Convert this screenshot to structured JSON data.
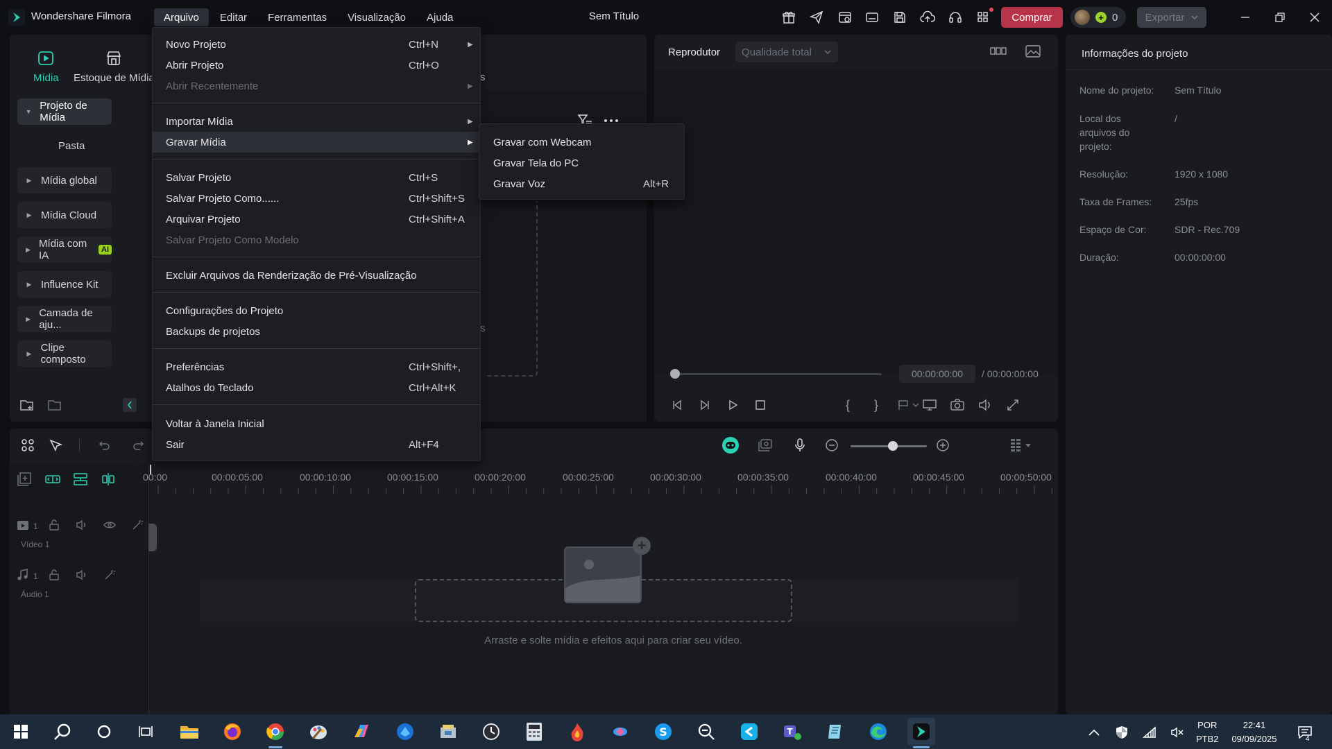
{
  "app": {
    "name": "Wondershare Filmora",
    "window_title": "Sem Título"
  },
  "menubar": [
    {
      "label": "Arquivo",
      "active": true
    },
    {
      "label": "Editar"
    },
    {
      "label": "Ferramentas"
    },
    {
      "label": "Visualização"
    },
    {
      "label": "Ajuda"
    }
  ],
  "titlebar": {
    "icons": [
      "gift-icon",
      "send-icon",
      "media-manager-icon",
      "subtitle-icon",
      "save-icon",
      "cloud-upload-icon",
      "headset-icon",
      "apps-grid-icon"
    ],
    "buy_label": "Comprar",
    "credits": "0",
    "export_label": "Exportar"
  },
  "media_panel": {
    "tabs": [
      {
        "label": "Mídia",
        "icon": "media-icon",
        "active": true
      },
      {
        "label": "Estoque de Mídia",
        "icon": "stock-media-icon"
      }
    ],
    "sidebar": [
      {
        "label": "Projeto de Mídia",
        "selected": true
      },
      {
        "label": "Pasta",
        "sub": true
      },
      {
        "label": "Mídia global"
      },
      {
        "label": "Mídia Cloud"
      },
      {
        "label": "Mídia com IA",
        "badge": "AI"
      },
      {
        "label": "Influence Kit"
      },
      {
        "label": "Camada de aju..."
      },
      {
        "label": "Clipe composto"
      }
    ],
    "partial_texts": [
      "s",
      "s"
    ]
  },
  "player": {
    "label": "Reprodutor",
    "quality": "Qualidade total",
    "current_time": "00:00:00:00",
    "total_time": "/  00:00:00:00"
  },
  "project_info": {
    "title": "Informações do projeto",
    "rows": [
      {
        "label": "Nome do projeto:",
        "value": "Sem Título"
      },
      {
        "label": "Local dos arquivos do projeto:",
        "value": "/"
      },
      {
        "label": "Resolução:",
        "value": "1920 x 1080"
      },
      {
        "label": "Taxa de Frames:",
        "value": "25fps"
      },
      {
        "label": "Espaço de Cor:",
        "value": "SDR - Rec.709"
      },
      {
        "label": "Duração:",
        "value": "00:00:00:00"
      }
    ]
  },
  "timeline": {
    "ruler": [
      "00:00",
      "00:00:05:00",
      "00:00:10:00",
      "00:00:15:00",
      "00:00:20:00",
      "00:00:25:00",
      "00:00:30:00",
      "00:00:35:00",
      "00:00:40:00",
      "00:00:45:00",
      "00:00:50:00"
    ],
    "tracks": [
      {
        "name": "Vídeo 1",
        "index": "1"
      },
      {
        "name": "Áudio 1",
        "index": "1"
      }
    ],
    "drop_hint": "Arraste e solte mídia e efeitos aqui para criar seu vídeo.",
    "zoom_level": 0.55
  },
  "file_menu": {
    "items": [
      {
        "label": "Novo Projeto",
        "shortcut": "Ctrl+N",
        "submenu": true
      },
      {
        "label": "Abrir Projeto",
        "shortcut": "Ctrl+O"
      },
      {
        "label": "Abrir Recentemente",
        "submenu": true,
        "disabled": true
      },
      {
        "label": "Importar Mídia",
        "submenu": true
      },
      {
        "label": "Gravar Mídia",
        "submenu": true,
        "hover": true
      },
      {
        "label": "Salvar Projeto",
        "shortcut": "Ctrl+S"
      },
      {
        "label": "Salvar Projeto Como......",
        "shortcut": "Ctrl+Shift+S"
      },
      {
        "label": "Arquivar Projeto",
        "shortcut": "Ctrl+Shift+A"
      },
      {
        "label": "Salvar Projeto Como Modelo",
        "disabled": true
      },
      {
        "label": "Excluir Arquivos da Renderização de Pré-Visualização"
      },
      {
        "label": "Configurações do Projeto"
      },
      {
        "label": "Backups de projetos"
      },
      {
        "label": "Preferências",
        "shortcut": "Ctrl+Shift+,"
      },
      {
        "label": "Atalhos do Teclado",
        "shortcut": "Ctrl+Alt+K"
      },
      {
        "label": "Voltar à Janela Inicial"
      },
      {
        "label": "Sair",
        "shortcut": "Alt+F4"
      }
    ]
  },
  "record_submenu": {
    "items": [
      {
        "label": "Gravar com Webcam"
      },
      {
        "label": "Gravar Tela do PC"
      },
      {
        "label": "Gravar Voz",
        "shortcut": "Alt+R"
      }
    ]
  },
  "taskbar": {
    "apps": [
      "windows-start-icon",
      "search-icon",
      "task-view-icon",
      "widgets-icon",
      "file-explorer-icon",
      "firefox-icon",
      "chrome-icon",
      "paint-icon",
      "copilot-icon",
      "onedrive-icon",
      "installer-icon",
      "clock-app-icon",
      "calculator-icon",
      "flame-app-icon",
      "photos-app-icon",
      "skype-icon",
      "magnifier-icon",
      "capcut-icon",
      "teams-icon",
      "notepad-icon",
      "edge-icon",
      "filmora-icon"
    ],
    "language": "POR",
    "layout": "PTB2",
    "time": "22:41",
    "date": "09/09/2025",
    "notifications": "4"
  },
  "colors": {
    "background": "#0f1014",
    "panel": "#1a1b20",
    "accent_buy": "#b8344a",
    "accent_green": "#9cd21c",
    "accent_teal": "#2ad1b2",
    "taskbar": "#1c2a3a"
  }
}
